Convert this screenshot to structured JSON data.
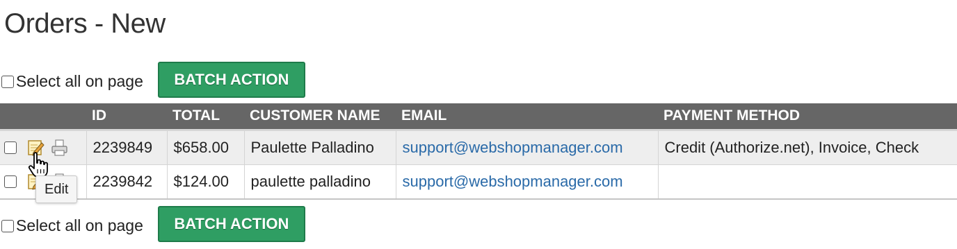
{
  "page": {
    "title": "Orders - New"
  },
  "batch": {
    "select_all_label": "Select all on page",
    "button_label": "BATCH ACTION"
  },
  "table": {
    "headers": {
      "actions": "",
      "id": "ID",
      "total": "TOTAL",
      "customer_name": "CUSTOMER NAME",
      "email": "EMAIL",
      "payment_method": "PAYMENT METHOD"
    },
    "rows": [
      {
        "id": "2239849",
        "total": "$658.00",
        "customer_name": "Paulette Palladino",
        "email": "support@webshopmanager.com",
        "payment_method": "Credit (Authorize.net), Invoice, Check"
      },
      {
        "id": "2239842",
        "total": "$124.00",
        "customer_name": "paulette palladino",
        "email": "support@webshopmanager.com",
        "payment_method": ""
      }
    ]
  },
  "tooltip": {
    "text": "Edit"
  },
  "icons": {
    "edit": "edit-icon",
    "print": "print-icon",
    "cursor": "pointer-hand-icon"
  },
  "colors": {
    "header_bg": "#666666",
    "button_bg": "#2f9e63",
    "link": "#2a6aa8",
    "row_alt": "#eeeeee"
  }
}
